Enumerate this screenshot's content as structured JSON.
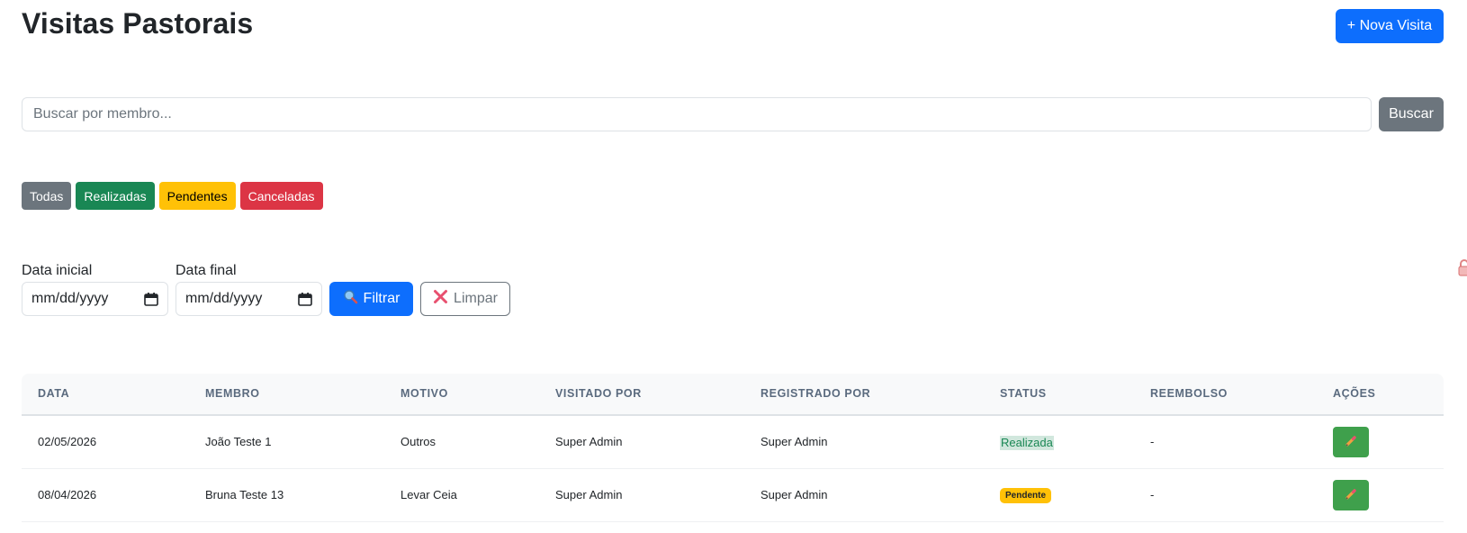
{
  "header": {
    "title": "Visitas Pastorais",
    "new_button": "+ Nova Visita"
  },
  "search": {
    "placeholder": "Buscar por membro...",
    "value": "",
    "button": "Buscar"
  },
  "status_filters": [
    "Todas",
    "Realizadas",
    "Pendentes",
    "Canceladas"
  ],
  "date_filter": {
    "start_label": "Data inicial",
    "end_label": "Data final",
    "start_value": "mm/dd/yyyy",
    "end_value": "mm/dd/yyyy",
    "filter_button": "Filtrar",
    "clear_button": "Limpar"
  },
  "table": {
    "columns": [
      "DATA",
      "MEMBRO",
      "MOTIVO",
      "VISITADO POR",
      "REGISTRADO POR",
      "STATUS",
      "REEMBOLSO",
      "AÇÕES"
    ],
    "rows": [
      [
        "02/05/2026",
        "João Teste 1",
        "Outros",
        "Super Admin",
        "Super Admin",
        "Realizada",
        "-"
      ],
      [
        "08/04/2026",
        "Bruna Teste 13",
        "Levar Ceia",
        "Super Admin",
        "Super Admin",
        "Pendente",
        "-"
      ]
    ]
  },
  "colors": {
    "primary": "#0d6efd",
    "secondary": "#6c757d",
    "success": "#198754",
    "warning": "#ffc107",
    "danger": "#dc3545",
    "edit": "#3fa04c"
  },
  "icons": {
    "filter": "magnifier-icon",
    "clear": "x-icon",
    "edit": "pencil-icon",
    "date": "calendar-icon"
  }
}
